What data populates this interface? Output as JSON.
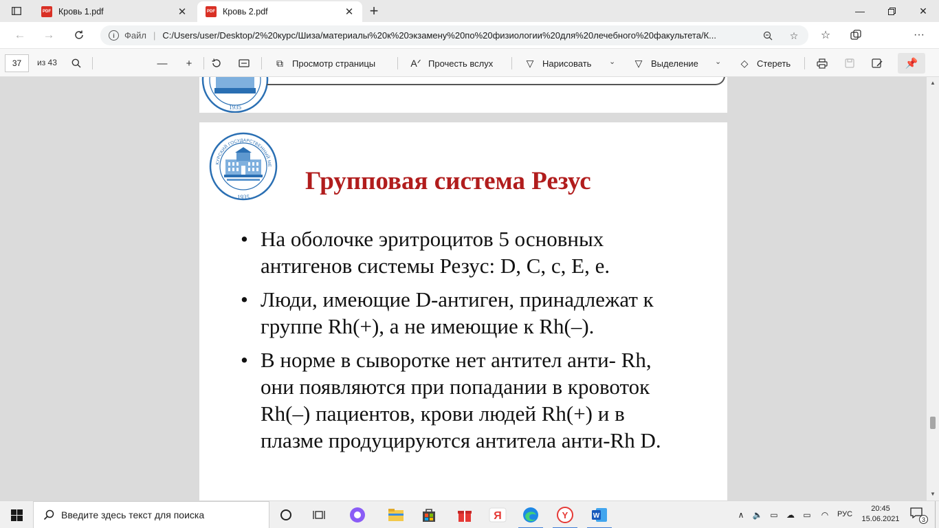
{
  "browser": {
    "tabs": [
      {
        "title": "Кровь 1.pdf",
        "icon": "pdf-icon",
        "active": false
      },
      {
        "title": "Кровь 2.pdf",
        "icon": "pdf-icon",
        "active": true
      }
    ],
    "address": {
      "scheme_label": "Файл",
      "url": "C:/Users/user/Desktop/2%20курс/Шиза/материалы%20к%20экзамену%20по%20физиологии%20для%20лечебного%20факультета/К..."
    }
  },
  "pdf_toolbar": {
    "page_current": "37",
    "page_total": "из 43",
    "page_view_label": "Просмотр страницы",
    "read_aloud_label": "Прочесть вслух",
    "draw_label": "Нарисовать",
    "highlight_label": "Выделение",
    "erase_label": "Стереть"
  },
  "document": {
    "logo_year": "1935",
    "logo_ring_text": "КУРСКИЙ ГОСУДАРСТВЕННЫЙ МЕДИЦИНСКИЙ УНИВЕРСИТЕТ",
    "slide_title": "Групповая система Резус",
    "slide_title_color": "#b11d1d",
    "bullets": [
      {
        "lines": [
          " На оболочке эритроцитов 5 основных",
          "антигенов системы Резус: D, C, c, E, e."
        ]
      },
      {
        "lines": [
          "Люди, имеющие D-антиген, принадлежат к",
          "группе Rh(+), а не имеющие к Rh(–)."
        ]
      },
      {
        "lines": [
          "В норме в сыворотке нет антител анти- Rh,",
          "они появляются при попадании в кровоток",
          "Rh(–) пациентов, крови людей Rh(+) и в",
          "плазме продуцируются антитела анти-Rh D."
        ]
      }
    ]
  },
  "taskbar": {
    "search_placeholder": "Введите здесь текст для поиска",
    "language": "РУС",
    "time": "20:45",
    "date": "15.06.2021",
    "notification_count": "3"
  }
}
